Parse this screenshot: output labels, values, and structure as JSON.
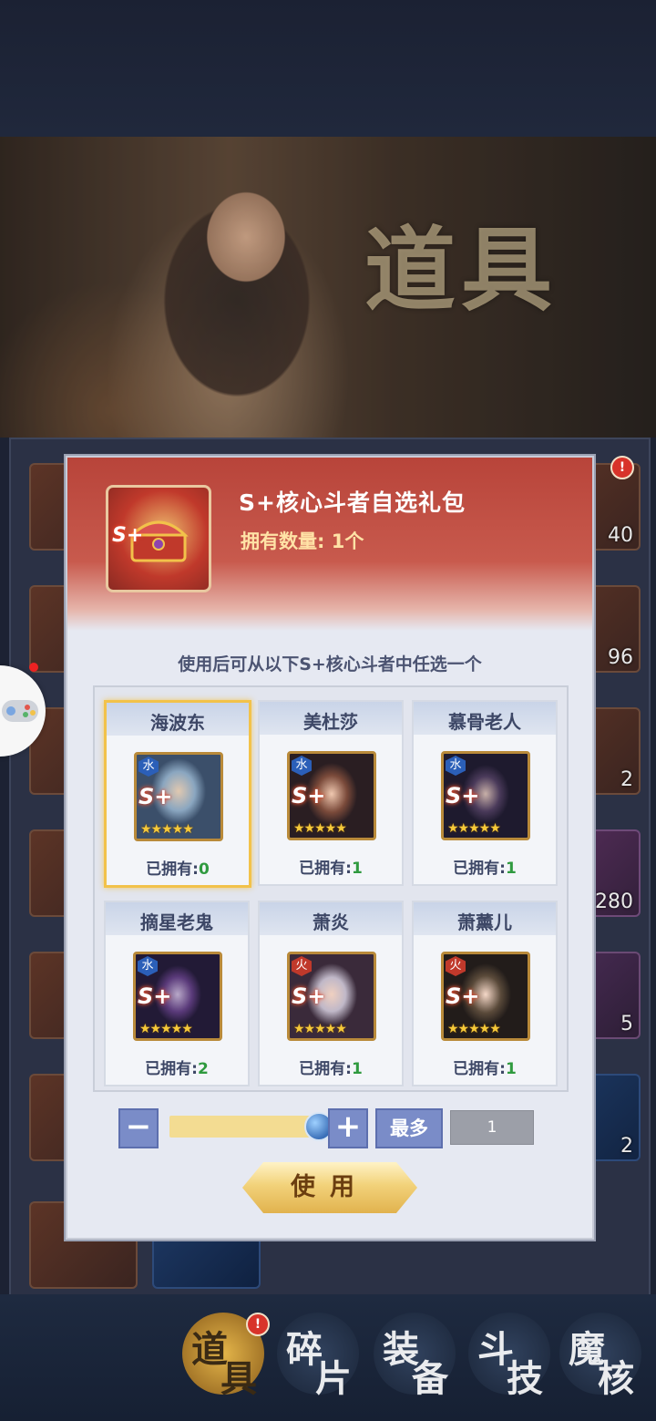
{
  "banner": {
    "title": "道具"
  },
  "background": {
    "counts": [
      "40",
      "96",
      "2",
      "280",
      "5",
      "2"
    ]
  },
  "nav": {
    "items": [
      {
        "c1": "道",
        "c2": "具"
      },
      {
        "c1": "碎",
        "c2": "片"
      },
      {
        "c1": "装",
        "c2": "备"
      },
      {
        "c1": "斗",
        "c2": "技"
      },
      {
        "c1": "魔",
        "c2": "核"
      }
    ],
    "badge": "!"
  },
  "dialog": {
    "item_rank": "S+",
    "title": "S+核心斗者自选礼包",
    "qty_label": "拥有数量:",
    "qty_value": "1个",
    "description": "使用后可从以下S+核心斗者中任选一个",
    "owned_label": "已拥有:",
    "cards": [
      {
        "name": "海波东",
        "element": "水",
        "rank": "S+",
        "stars": "★★★★★",
        "owned": "0",
        "selected": true
      },
      {
        "name": "美杜莎",
        "element": "水",
        "rank": "S+",
        "stars": "★★★★★",
        "owned": "1",
        "selected": false
      },
      {
        "name": "慕骨老人",
        "element": "水",
        "rank": "S+",
        "stars": "★★★★★",
        "owned": "1",
        "selected": false
      },
      {
        "name": "摘星老鬼",
        "element": "水",
        "rank": "S+",
        "stars": "★★★★★",
        "owned": "2",
        "selected": false
      },
      {
        "name": "萧炎",
        "element": "火",
        "rank": "S+",
        "stars": "★★★★★",
        "owned": "1",
        "selected": false
      },
      {
        "name": "萧薰儿",
        "element": "火",
        "rank": "S+",
        "stars": "★★★★★",
        "owned": "1",
        "selected": false
      }
    ],
    "controls": {
      "minus": "−",
      "plus": "+",
      "slider_fraction": 1.0,
      "max_label": "最多",
      "quantity": "1"
    },
    "use_label": "使用"
  }
}
